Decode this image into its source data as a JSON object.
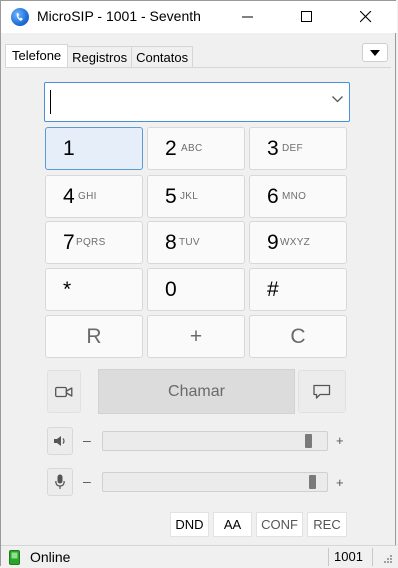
{
  "window": {
    "title": "MicroSIP - 1001 - Seventh",
    "app_icon": "microsip-logo-icon",
    "controls": {
      "minimize": "minimize-icon",
      "maximize": "maximize-icon",
      "close": "close-icon"
    }
  },
  "tabs": [
    {
      "label": "Telefone",
      "active": true
    },
    {
      "label": "Registros",
      "active": false
    },
    {
      "label": "Contatos",
      "active": false
    }
  ],
  "menu_button_icon": "triangle-down-icon",
  "dialer": {
    "number_value": "",
    "dropdown_icon": "chevron-down-icon"
  },
  "keypad": [
    {
      "digit": "1",
      "letters": ""
    },
    {
      "digit": "2",
      "letters": "ABC"
    },
    {
      "digit": "3",
      "letters": "DEF"
    },
    {
      "digit": "4",
      "letters": "GHI"
    },
    {
      "digit": "5",
      "letters": "JKL"
    },
    {
      "digit": "6",
      "letters": "MNO"
    },
    {
      "digit": "7",
      "letters": "PQRS"
    },
    {
      "digit": "8",
      "letters": "TUV"
    },
    {
      "digit": "9",
      "letters": "WXYZ"
    },
    {
      "digit": "*",
      "letters": ""
    },
    {
      "digit": "0",
      "letters": ""
    },
    {
      "digit": "#",
      "letters": ""
    }
  ],
  "function_keys": {
    "redial": "R",
    "plus": "+",
    "clear": "C"
  },
  "call_row": {
    "video_icon": "video-camera-icon",
    "call_label": "Chamar",
    "message_icon": "chat-bubble-icon"
  },
  "speaker": {
    "icon": "speaker-icon",
    "minus": "–",
    "plus": "+",
    "level": 0.94
  },
  "microphone": {
    "icon": "microphone-icon",
    "minus": "–",
    "plus": "+",
    "level": 0.96
  },
  "options": {
    "dnd": "DND",
    "aa": "AA",
    "conf": "CONF",
    "rec": "REC"
  },
  "status": {
    "icon": "online-phone-icon",
    "text": "Online",
    "extension": "1001"
  },
  "colors": {
    "accent": "#4a90d9",
    "online": "#2aa52a"
  }
}
